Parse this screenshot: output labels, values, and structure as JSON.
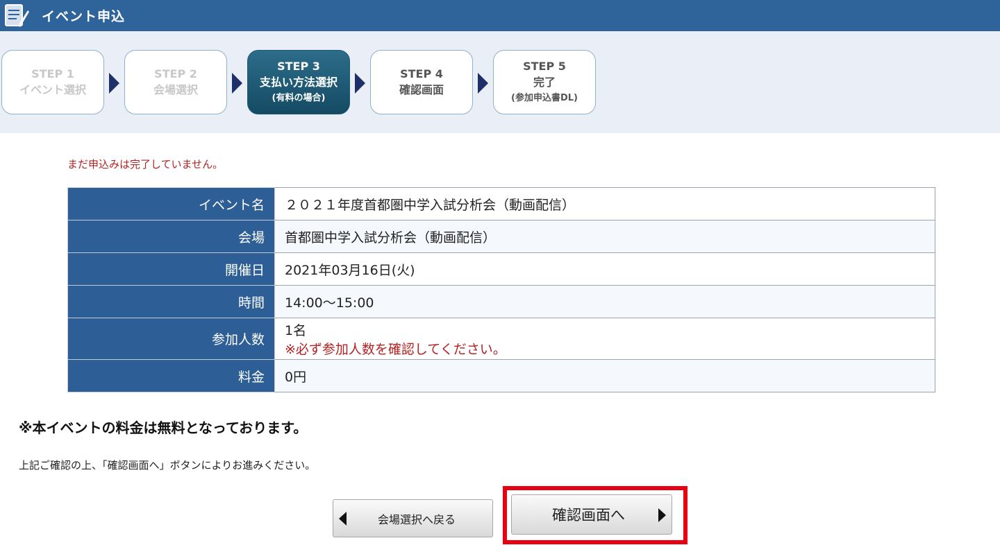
{
  "header": {
    "title": "イベント申込",
    "icon": "document-pencil-icon"
  },
  "steps": [
    {
      "num": "STEP 1",
      "name": "イベント選択",
      "sub": "",
      "state": "done"
    },
    {
      "num": "STEP 2",
      "name": "会場選択",
      "sub": "",
      "state": "done"
    },
    {
      "num": "STEP 3",
      "name": "支払い方法選択",
      "sub": "(有料の場合)",
      "state": "active"
    },
    {
      "num": "STEP 4",
      "name": "確認画面",
      "sub": "",
      "state": "future"
    },
    {
      "num": "STEP 5",
      "name": "完了",
      "sub": "(参加申込書DL)",
      "state": "future"
    }
  ],
  "notice": "まだ申込みは完了していません。",
  "table": [
    {
      "label": "イベント名",
      "value": "２０２１年度首都圏中学入試分析会（動画配信）"
    },
    {
      "label": "会場",
      "value": "首都圏中学入試分析会（動画配信）"
    },
    {
      "label": "開催日",
      "value": "2021年03月16日(火)"
    },
    {
      "label": "時間",
      "value": "14:00～15:00"
    },
    {
      "label": "参加人数",
      "value": "1名",
      "warning": "※必ず参加人数を確認してください。"
    },
    {
      "label": "料金",
      "value": "0円"
    }
  ],
  "free_note": "※本イベントの料金は無料となっております。",
  "guide": "上記ご確認の上、「確認画面へ」ボタンによりお進みください。",
  "buttons": {
    "back": "会場選択へ戻る",
    "next": "確認画面へ"
  },
  "colors": {
    "header": "#2e6499",
    "active_step": "#1b5a74",
    "table_header": "#2d5f96",
    "warning": "#b32222",
    "highlight": "#e60012"
  }
}
